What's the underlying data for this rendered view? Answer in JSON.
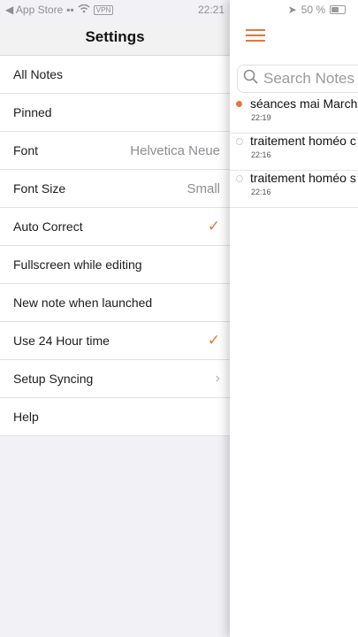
{
  "status_bar": {
    "back_label": "◀ App Store",
    "time": "22:21",
    "battery": "50 %"
  },
  "settings": {
    "title": "Settings",
    "items": [
      {
        "label": "All Notes",
        "value": "",
        "accessory": "none"
      },
      {
        "label": "Pinned",
        "value": "",
        "accessory": "none"
      },
      {
        "label": "Font",
        "value": "Helvetica Neue",
        "accessory": "none"
      },
      {
        "label": "Font Size",
        "value": "Small",
        "accessory": "none"
      },
      {
        "label": "Auto Correct",
        "value": "",
        "accessory": "check"
      },
      {
        "label": "Fullscreen while editing",
        "value": "",
        "accessory": "none"
      },
      {
        "label": "New note when launched",
        "value": "",
        "accessory": "none"
      },
      {
        "label": "Use 24 Hour time",
        "value": "",
        "accessory": "check"
      },
      {
        "label": "Setup Syncing",
        "value": "",
        "accessory": "chevron"
      },
      {
        "label": "Help",
        "value": "",
        "accessory": "none"
      }
    ]
  },
  "notes_pane": {
    "search_placeholder": "Search Notes",
    "notes": [
      {
        "title": "séances mai March",
        "time": "22:19",
        "unread": true
      },
      {
        "title": "traitement homéo c",
        "time": "22:16",
        "unread": false
      },
      {
        "title": "traitement homéo s",
        "time": "22:16",
        "unread": false
      }
    ]
  },
  "colors": {
    "accent": "#e8743b",
    "secondary_text": "#8e8e93",
    "header_bg": "#f2f2f2"
  },
  "icons": [
    "back-arrow-icon",
    "signal-icon",
    "wifi-icon",
    "location-icon",
    "battery-icon",
    "hamburger-menu-icon",
    "search-icon",
    "checkmark-icon",
    "chevron-right-icon"
  ]
}
